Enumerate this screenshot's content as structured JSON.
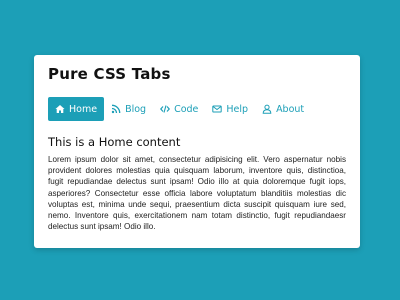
{
  "card": {
    "title": "Pure CSS Tabs"
  },
  "tabs": [
    {
      "label": "Home",
      "icon": "home-icon",
      "active": true
    },
    {
      "label": "Blog",
      "icon": "rss-icon",
      "active": false
    },
    {
      "label": "Code",
      "icon": "code-icon",
      "active": false
    },
    {
      "label": "Help",
      "icon": "envelope-icon",
      "active": false
    },
    {
      "label": "About",
      "icon": "user-icon",
      "active": false
    }
  ],
  "content": {
    "heading": "This is a Home content",
    "body": "Lorem ipsum dolor sit amet, consectetur adipisicing elit. Vero aspernatur nobis provident dolores molestias quia quisquam laborum, inventore quis, distinctioa, fugit repudiandae delectus sunt ipsam! Odio illo at quia doloremque fugit iops, asperiores? Consectetur esse officia labore voluptatum blanditiis molestias dic voluptas est, minima unde sequi, praesentium dicta suscipit quisquam iure sed, nemo. Inventore quis, exercitationem nam totam distinctio, fugit repudiandaesr delectus sunt ipsam! Odio illo."
  },
  "colors": {
    "background": "#1c9fb7",
    "accent": "#1c9fb7",
    "card": "#ffffff"
  }
}
